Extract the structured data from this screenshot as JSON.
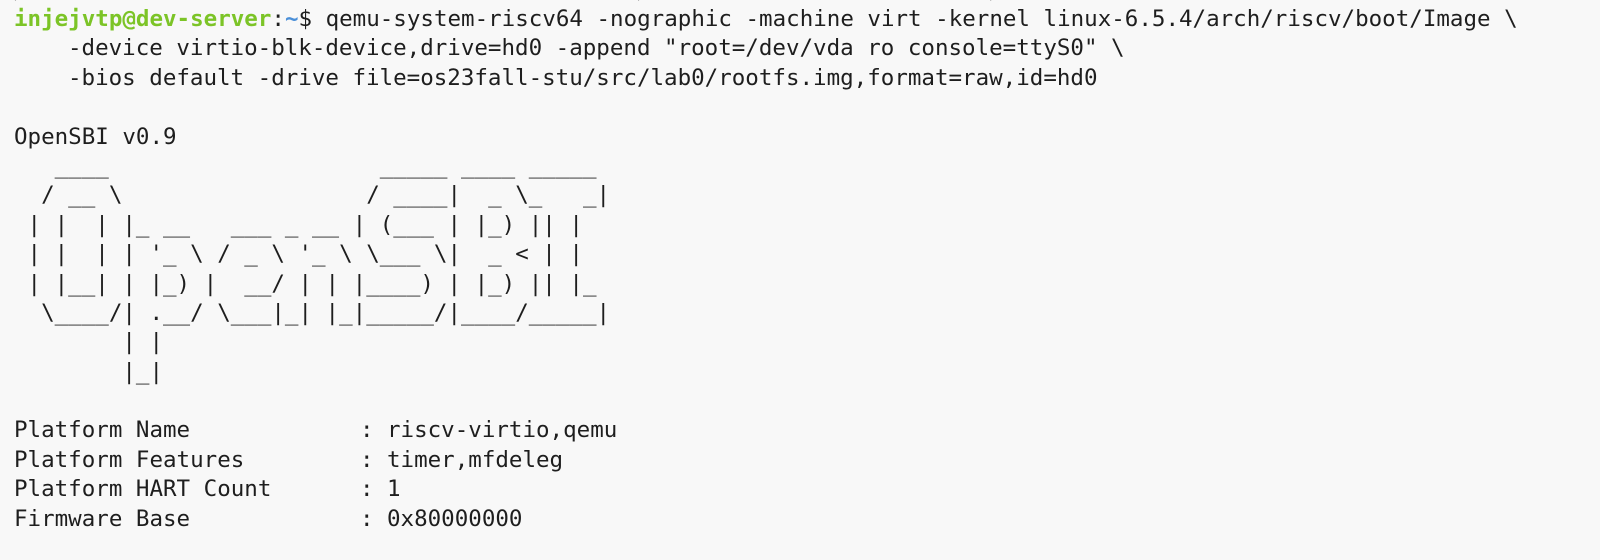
{
  "terminal": {
    "cut_line": ">                                             >                         >",
    "prompt": {
      "user_host": "injejvtp@dev-server",
      "separator": ":",
      "path": "~",
      "symbol": "$ "
    },
    "command": [
      "qemu-system-riscv64 -nographic -machine virt -kernel linux-6.5.4/arch/riscv/boot/Image \\",
      "-device virtio-blk-device,drive=hd0 -append \"root=/dev/vda ro console=ttyS0\" \\",
      "-bios default -drive file=os23fall-stu/src/lab0/rootfs.img,format=raw,id=hd0"
    ],
    "banner_title": "OpenSBI v0.9",
    "logo_lines": [
      "   ____                    _____ ____ _____",
      "  / __ \\                  / ____|  _ \\_   _|",
      " | |  | |_ __   ___ _ __ | (___ | |_) || |",
      " | |  | | '_ \\ / _ \\ '_ \\ \\___ \\|  _ < | |",
      " | |__| | |_) |  __/ | | |____) | |_) || |_",
      "  \\____/| .__/ \\___|_| |_|_____/|____/_____|",
      "        | |",
      "        |_|"
    ],
    "platform_info": [
      {
        "key": "Platform Name",
        "value": "riscv-virtio,qemu"
      },
      {
        "key": "Platform Features",
        "value": "timer,mfdeleg"
      },
      {
        "key": "Platform HART Count",
        "value": "1"
      },
      {
        "key": "Firmware Base",
        "value": "0x80000000"
      }
    ],
    "colon": ":",
    "colors": {
      "background": "#f8f8f8",
      "foreground": "#1e1e1e",
      "prompt_user": "#7cc427",
      "prompt_path": "#4a8fd8"
    }
  }
}
